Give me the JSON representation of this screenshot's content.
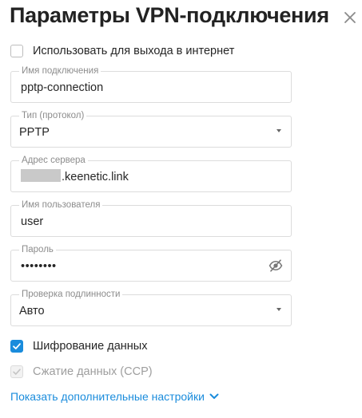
{
  "dialog": {
    "title": "Параметры VPN-подключения",
    "close_icon": "close-icon"
  },
  "use_for_internet": {
    "label": "Использовать для выхода в интернет",
    "checked": false
  },
  "connection_name": {
    "label": "Имя подключения",
    "value": "pptp-connection"
  },
  "protocol": {
    "label": "Тип (протокол)",
    "value": "PPTP"
  },
  "server_address": {
    "label": "Адрес сервера",
    "value": ".keenetic.link"
  },
  "username": {
    "label": "Имя пользователя",
    "value": "user"
  },
  "password": {
    "label": "Пароль",
    "value": "••••••••",
    "toggle_icon": "eye-off-icon"
  },
  "auth_check": {
    "label": "Проверка подлинности",
    "value": "Авто"
  },
  "encryption": {
    "label": "Шифрование данных",
    "checked": true
  },
  "compression": {
    "label": "Сжатие данных (CCP)",
    "checked": true,
    "disabled": true
  },
  "advanced_link": {
    "label": "Показать дополнительные настройки",
    "icon": "chevron-down-icon"
  },
  "colors": {
    "accent": "#1a8cdc",
    "text": "#262626",
    "border": "#dcdcdc",
    "label": "#8c8c8c"
  }
}
